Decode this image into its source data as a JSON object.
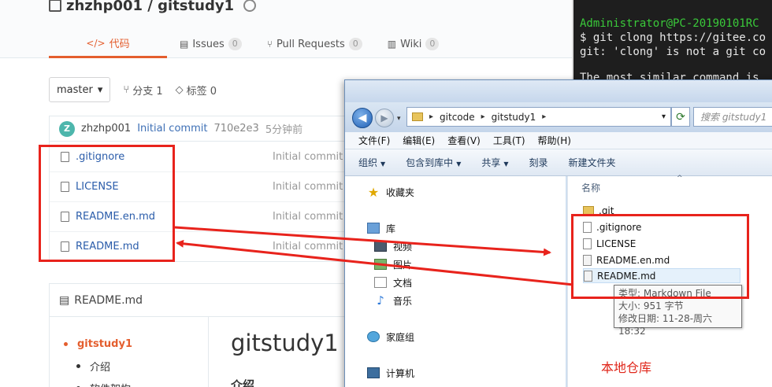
{
  "repo": {
    "title": "zhzhp001 / gitstudy1",
    "tabs": [
      {
        "label": "代码",
        "count": ""
      },
      {
        "label": "Issues",
        "count": "0"
      },
      {
        "label": "Pull Requests",
        "count": "0"
      },
      {
        "label": "Wiki",
        "count": "0"
      }
    ],
    "branch": "master",
    "branches_label": "分支 1",
    "tags_label": "标签 0",
    "commit": {
      "avatar": "Z",
      "user": "zhzhp001",
      "message": "Initial commit",
      "sha": "710e2e3",
      "time": "5分钟前"
    },
    "files": [
      {
        "name": ".gitignore",
        "commit": "Initial commit"
      },
      {
        "name": "LICENSE",
        "commit": "Initial commit"
      },
      {
        "name": "README.en.md",
        "commit": "Initial commit"
      },
      {
        "name": "README.md",
        "commit": "Initial commit"
      }
    ],
    "readme": {
      "header": "README.md",
      "toc": [
        "gitstudy1",
        "介绍",
        "软件架构"
      ],
      "title": "gitstudy1",
      "subtitle": "介绍"
    }
  },
  "terminal": {
    "lines": [
      "Administrator@PC-20190101RC",
      "$ git clong https://gitee.co",
      "git: 'clong' is not a git co",
      "",
      "The most similar command is"
    ]
  },
  "explorer": {
    "address": [
      "gitcode",
      "gitstudy1"
    ],
    "search_placeholder": "搜索 gitstudy1",
    "menu": [
      "文件(F)",
      "编辑(E)",
      "查看(V)",
      "工具(T)",
      "帮助(H)"
    ],
    "commands": [
      "组织",
      "包含到库中",
      "共享",
      "刻录",
      "新建文件夹"
    ],
    "nav": {
      "favorites": "收藏夹",
      "library": "库",
      "video": "视频",
      "pictures": "图片",
      "documents": "文档",
      "music": "音乐",
      "homegroup": "家庭组",
      "computer": "计算机"
    },
    "column": "名称",
    "files": [
      ".git",
      ".gitignore",
      "LICENSE",
      "README.en.md",
      "README.md"
    ],
    "tooltip": {
      "type": "类型: Markdown File",
      "size": "大小: 951 字节",
      "modified": "修改日期: 11-28-周六 18:32"
    }
  },
  "annotation": {
    "local_repo": "本地仓库",
    "color": "#e8231c"
  }
}
